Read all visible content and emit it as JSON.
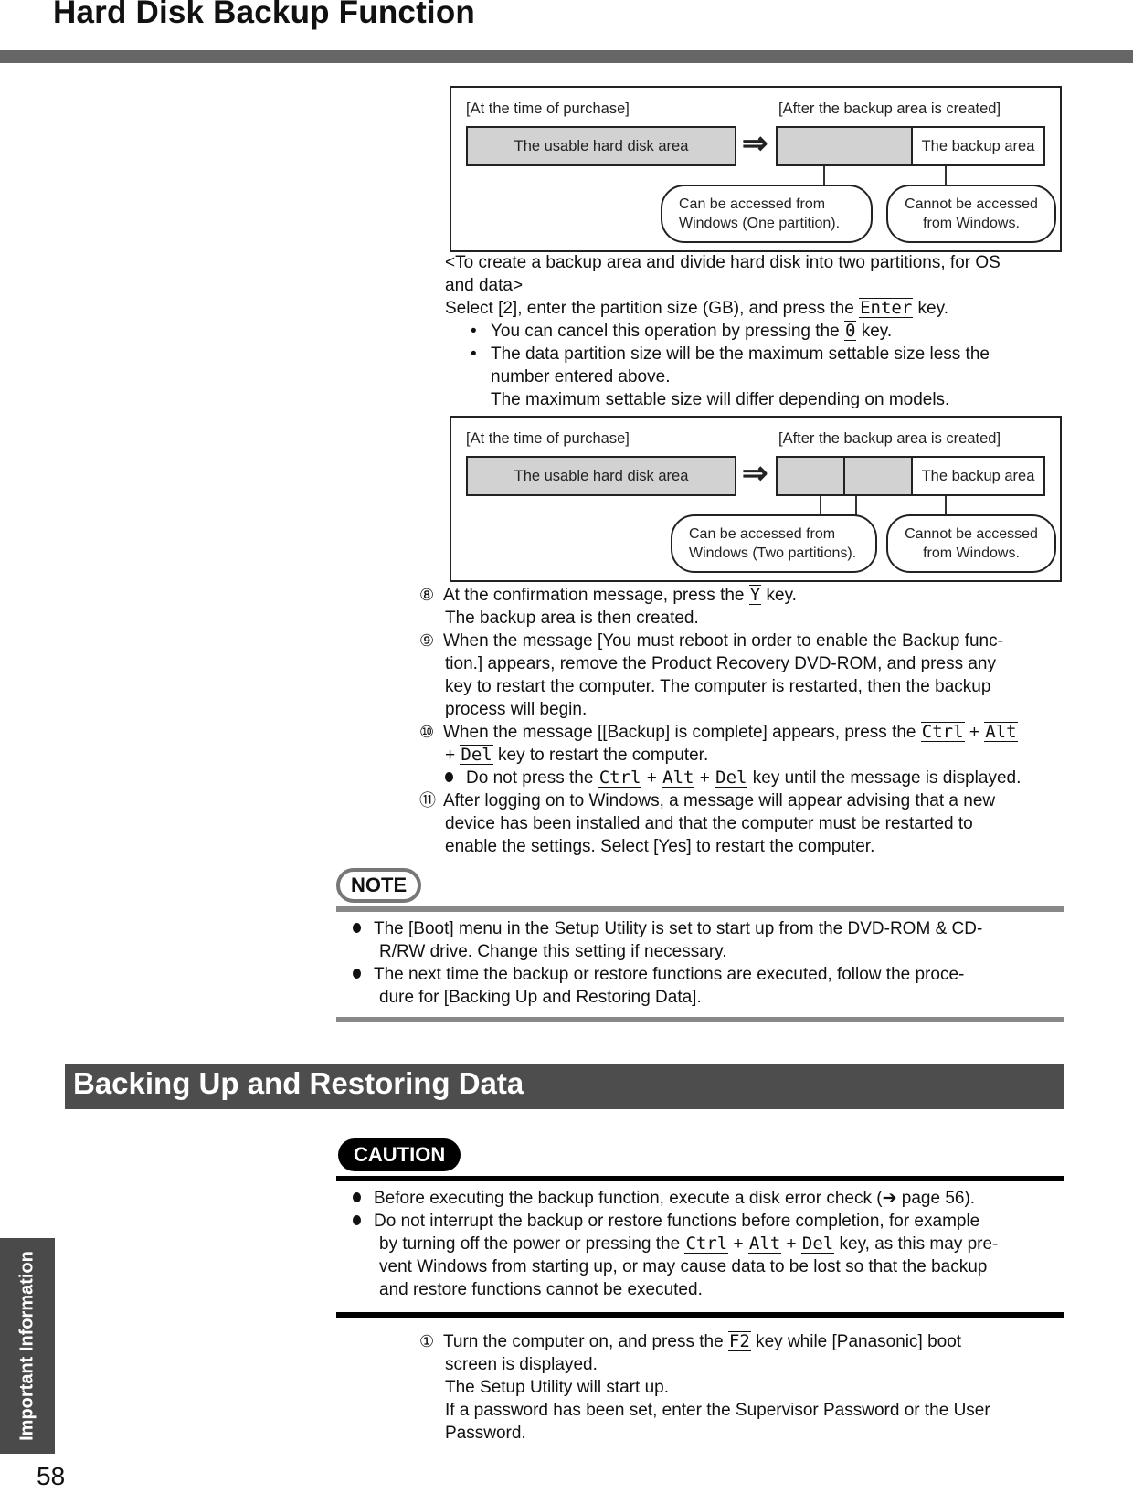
{
  "header": {
    "title": "Hard Disk Backup Function"
  },
  "diagram1": {
    "purchase_label": "[At the time of purchase]",
    "after_label": "[After the backup area is created]",
    "usable_area": "The usable hard disk area",
    "backup_area": "The backup area",
    "accessible_line1": "Can be accessed from",
    "accessible_line2": "Windows (One partition).",
    "not_accessible_line1": "Cannot be accessed",
    "not_accessible_line2": "from Windows."
  },
  "two_partitions": {
    "heading_line1": "<To create a backup area and divide hard disk into two partitions, for OS",
    "heading_line2": "and data>",
    "instr_pre": "Select [2], enter the partition size (GB), and press the",
    "instr_key": "Enter",
    "instr_post": "key.",
    "bullets": [
      {
        "pre": "You can cancel this operation by pressing the",
        "key": "0",
        "post": "key."
      },
      {
        "line1": "The data partition size will be the maximum settable size less the",
        "line2": "number entered above.",
        "line3": "The maximum settable size will differ depending on models."
      }
    ]
  },
  "diagram2": {
    "purchase_label": "[At the time of purchase]",
    "after_label": "[After the backup area is created]",
    "usable_area": "The usable hard disk area",
    "backup_area": "The backup area",
    "accessible_line1": "Can be accessed from",
    "accessible_line2": "Windows (Two partitions).",
    "not_accessible_line1": "Cannot be accessed",
    "not_accessible_line2": "from Windows."
  },
  "steps": {
    "s8": {
      "num": "⑧",
      "pre": "At the confirmation message, press the",
      "key": "Y",
      "post": "key.",
      "line2": "The backup area is then created."
    },
    "s9": {
      "num": "⑨",
      "line1": "When the message [You must reboot in order to enable the Backup func-",
      "line2": "tion.] appears, remove the Product Recovery DVD-ROM, and press any",
      "line3": "key to restart the computer. The computer is restarted, then the backup",
      "line4": "process will begin."
    },
    "s10": {
      "num": "⑩",
      "pre": "When the message [[Backup] is complete] appears, press the",
      "key1": "Ctrl",
      "plus": "+",
      "key2": "Alt",
      "key3": "Del",
      "post": "key to restart the computer.",
      "bullet_pre": "Do not press the",
      "bullet_post": "key until the message is displayed."
    },
    "s11": {
      "num": "⑪",
      "line1": "After logging on to Windows, a message will appear advising that a new",
      "line2": "device has been installed and that the computer must be restarted to",
      "line3": "enable the settings.  Select [Yes] to restart the computer."
    }
  },
  "note": {
    "badge": "NOTE",
    "items": [
      {
        "line1": "The [Boot] menu in the Setup Utility is set to start up from the DVD-ROM & CD-",
        "line2": "R/RW drive. Change this setting if necessary."
      },
      {
        "line1": "The next time the backup or restore functions are executed, follow the proce-",
        "line2": "dure for [Backing Up and Restoring Data]."
      }
    ]
  },
  "section": {
    "title": "Backing Up and Restoring Data"
  },
  "caution": {
    "badge": "CAUTION",
    "item1_pre": "Before executing the backup function, execute a disk error check (",
    "item1_arrow": "➔",
    "item1_post": " page 56).",
    "item2_line1": "Do not interrupt the backup or restore functions before completion, for example",
    "item2_pre": "by turning off the power or pressing the",
    "item2_post": "key, as this may pre-",
    "item2_line3": "vent Windows from starting up, or may cause data to be lost so that the backup",
    "item2_line4": "and restore functions cannot be executed.",
    "key1": "Ctrl",
    "key2": "Alt",
    "key3": "Del",
    "plus": "+"
  },
  "restore_steps": {
    "s1": {
      "num": "①",
      "pre": "Turn the computer on, and press the",
      "key": "F2",
      "post": "key while [Panasonic] boot",
      "line2": "screen is displayed.",
      "line3": "The Setup Utility will start up.",
      "line4": "If a password has been set, enter the Supervisor Password or the User",
      "line5": "Password."
    }
  },
  "side_tab": {
    "label": "Important Information"
  },
  "footer": {
    "page_number": "58"
  }
}
